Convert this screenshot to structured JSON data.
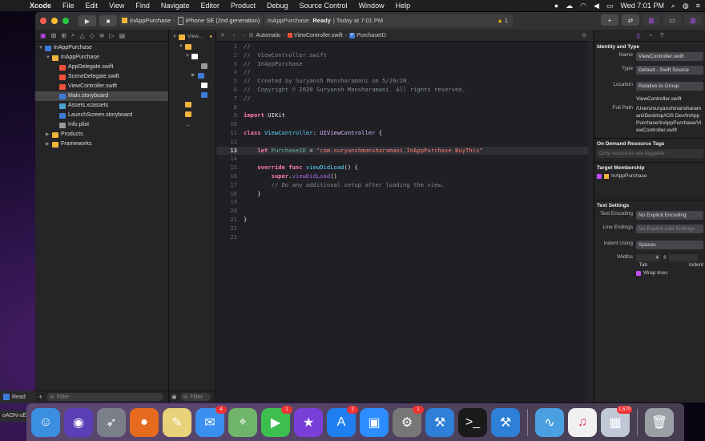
{
  "menubar": {
    "app": "Xcode",
    "items": [
      "File",
      "Edit",
      "View",
      "Find",
      "Navigate",
      "Editor",
      "Product",
      "Debug",
      "Source Control",
      "Window",
      "Help"
    ],
    "clock": "Wed 7:01 PM"
  },
  "toolbar": {
    "scheme": "InAppPurchase",
    "device": "iPhone SE (2nd generation)",
    "status_project": "InAppPurchase:",
    "status_state": "Ready",
    "status_time": "| Today at 7:01 PM",
    "warning_count": "1",
    "play_icon": "play-icon",
    "stop_icon": "stop-icon"
  },
  "navigator": {
    "items": [
      {
        "label": "InAppPurchase",
        "indent": 0,
        "icon": "project",
        "open": true
      },
      {
        "label": "InAppPurchase",
        "indent": 1,
        "icon": "folder",
        "open": true
      },
      {
        "label": "AppDelegate.swift",
        "indent": 2,
        "icon": "swift"
      },
      {
        "label": "SceneDelegate.swift",
        "indent": 2,
        "icon": "swift"
      },
      {
        "label": "ViewController.swift",
        "indent": 2,
        "icon": "swift"
      },
      {
        "label": "Main.storyboard",
        "indent": 2,
        "icon": "storyboard",
        "selected": true
      },
      {
        "label": "Assets.xcassets",
        "indent": 2,
        "icon": "assets"
      },
      {
        "label": "LaunchScreen.storyboard",
        "indent": 2,
        "icon": "storyboard"
      },
      {
        "label": "Info.plist",
        "indent": 2,
        "icon": "plist"
      },
      {
        "label": "Products",
        "indent": 1,
        "icon": "folder",
        "open": false
      },
      {
        "label": "Frameworks",
        "indent": 1,
        "icon": "folder",
        "open": false
      }
    ],
    "filter_placeholder": "Filter"
  },
  "outline": {
    "title": "View...",
    "filter_placeholder": "Filter"
  },
  "jumpbar": {
    "mode": "Automatic",
    "file": "ViewController.swift",
    "symbol": "PurchaseID"
  },
  "code": {
    "current_line": 13,
    "lines": [
      [
        [
          "//",
          "comment"
        ]
      ],
      [
        [
          "//  ViewController.swift",
          "comment"
        ]
      ],
      [
        [
          "//  InAppPurchase",
          "comment"
        ]
      ],
      [
        [
          "//",
          "comment"
        ]
      ],
      [
        [
          "//  Created by Suryansh Mansharamani on 5/20/20.",
          "comment"
        ]
      ],
      [
        [
          "//  Copyright © 2020 Suryansh Mansharamani. All rights reserved.",
          "comment"
        ]
      ],
      [
        [
          "//",
          "comment"
        ]
      ],
      [],
      [
        [
          "import",
          "kw"
        ],
        [
          " UIKit",
          "plain"
        ]
      ],
      [],
      [
        [
          "class",
          "kw"
        ],
        [
          " ",
          "plain"
        ],
        [
          "ViewController",
          "cls"
        ],
        [
          ": ",
          "plain"
        ],
        [
          "UIViewController",
          "type"
        ],
        [
          " {",
          "plain"
        ]
      ],
      [],
      [
        [
          "    ",
          "plain"
        ],
        [
          "let",
          "kw"
        ],
        [
          " ",
          "plain"
        ],
        [
          "PurchaseID",
          "fn"
        ],
        [
          " = ",
          "plain"
        ],
        [
          "\"com.suryanshmansharamani.InAppPurchase.BuyThis\"",
          "str"
        ]
      ],
      [],
      [
        [
          "    ",
          "plain"
        ],
        [
          "override",
          "kw"
        ],
        [
          " ",
          "plain"
        ],
        [
          "func",
          "kw"
        ],
        [
          " ",
          "plain"
        ],
        [
          "viewDidLoad",
          "cls"
        ],
        [
          "() {",
          "plain"
        ]
      ],
      [
        [
          "        ",
          "plain"
        ],
        [
          "super",
          "kw"
        ],
        [
          ".",
          "plain"
        ],
        [
          "viewDidLoad",
          "call"
        ],
        [
          "()",
          "plain"
        ]
      ],
      [
        [
          "        ",
          "plain"
        ],
        [
          "// Do any additional setup after loading the view.",
          "comment"
        ]
      ],
      [
        [
          "    }",
          "plain"
        ]
      ],
      [],
      [],
      [
        [
          "}",
          "plain"
        ]
      ],
      [],
      []
    ]
  },
  "inspector": {
    "identity_title": "Identity and Type",
    "name_label": "Name",
    "name_value": "ViewController.swift",
    "type_label": "Type",
    "type_value": "Default - Swift Source",
    "location_label": "Location",
    "location_value": "Relative to Group",
    "location_file": "ViewController.swift",
    "fullpath_label": "Full Path",
    "fullpath_value": "/Users/suryanshmansharamani/Desktop/iOS Dev/InAppPurchase/InAppPurchase/ViewController.swift",
    "odr_title": "On Demand Resource Tags",
    "odr_placeholder": "Only resources are taggable",
    "target_title": "Target Membership",
    "target_name": "InAppPurchase",
    "text_title": "Text Settings",
    "encoding_label": "Text Encoding",
    "encoding_value": "No Explicit Encoding",
    "endings_label": "Line Endings",
    "endings_value": "No Explicit Line Endings",
    "indent_label": "Indent Using",
    "indent_value": "Spaces",
    "widths_label": "Widths",
    "tab_width": "4",
    "tab_label": "Tab",
    "indent_sub_label": "Indent",
    "wrap_label": "Wrap lines"
  },
  "dock": {
    "apps": [
      {
        "name": "finder-icon",
        "color": "#3b8fe0",
        "glyph": "☺"
      },
      {
        "name": "siri-icon",
        "color": "#5a3fb8",
        "glyph": "◉"
      },
      {
        "name": "launchpad-icon",
        "color": "#7a7f8a",
        "glyph": "➶"
      },
      {
        "name": "firefox-icon",
        "color": "#e76b1f",
        "glyph": "●"
      },
      {
        "name": "notes-icon",
        "color": "#e8d27a",
        "glyph": "✎"
      },
      {
        "name": "messages-icon",
        "color": "#3a8ff0",
        "glyph": "✉",
        "badge": "4"
      },
      {
        "name": "maps-icon",
        "color": "#6fb46a",
        "glyph": "⌖"
      },
      {
        "name": "facetime-icon",
        "color": "#3cbf4e",
        "glyph": "▶",
        "badge": "1"
      },
      {
        "name": "imovie-icon",
        "color": "#7a3fd8",
        "glyph": "★"
      },
      {
        "name": "appstore-icon",
        "color": "#1f7ff0",
        "glyph": "A",
        "badge": "2"
      },
      {
        "name": "zoom-icon",
        "color": "#2d8cff",
        "glyph": "▣"
      },
      {
        "name": "system-preferences-icon",
        "color": "#777",
        "glyph": "⚙",
        "badge": "1"
      },
      {
        "name": "xcode-icon",
        "color": "#2d7fd8",
        "glyph": "⚒"
      },
      {
        "name": "terminal-icon",
        "color": "#1a1a1a",
        "glyph": ">_"
      },
      {
        "name": "xcode-beta-icon",
        "color": "#2d7fd8",
        "glyph": "⚒"
      },
      {
        "name": "separator"
      },
      {
        "name": "instruments-icon",
        "color": "#4aa0e0",
        "glyph": "∿"
      },
      {
        "name": "music-icon",
        "color": "#f0f0f0",
        "glyph": "♫"
      },
      {
        "name": "preview-icon",
        "color": "#c0c8d8",
        "glyph": "▦",
        "badge": "1,570"
      },
      {
        "name": "separator"
      },
      {
        "name": "trash-icon",
        "color": "#9aa0a6",
        "glyph": "🗑"
      }
    ]
  },
  "desktop": {
    "left_tab": "Read",
    "left_tab2": "oAON-uE"
  },
  "colors": {
    "accent": "#c44dff",
    "selection": "#464649"
  }
}
